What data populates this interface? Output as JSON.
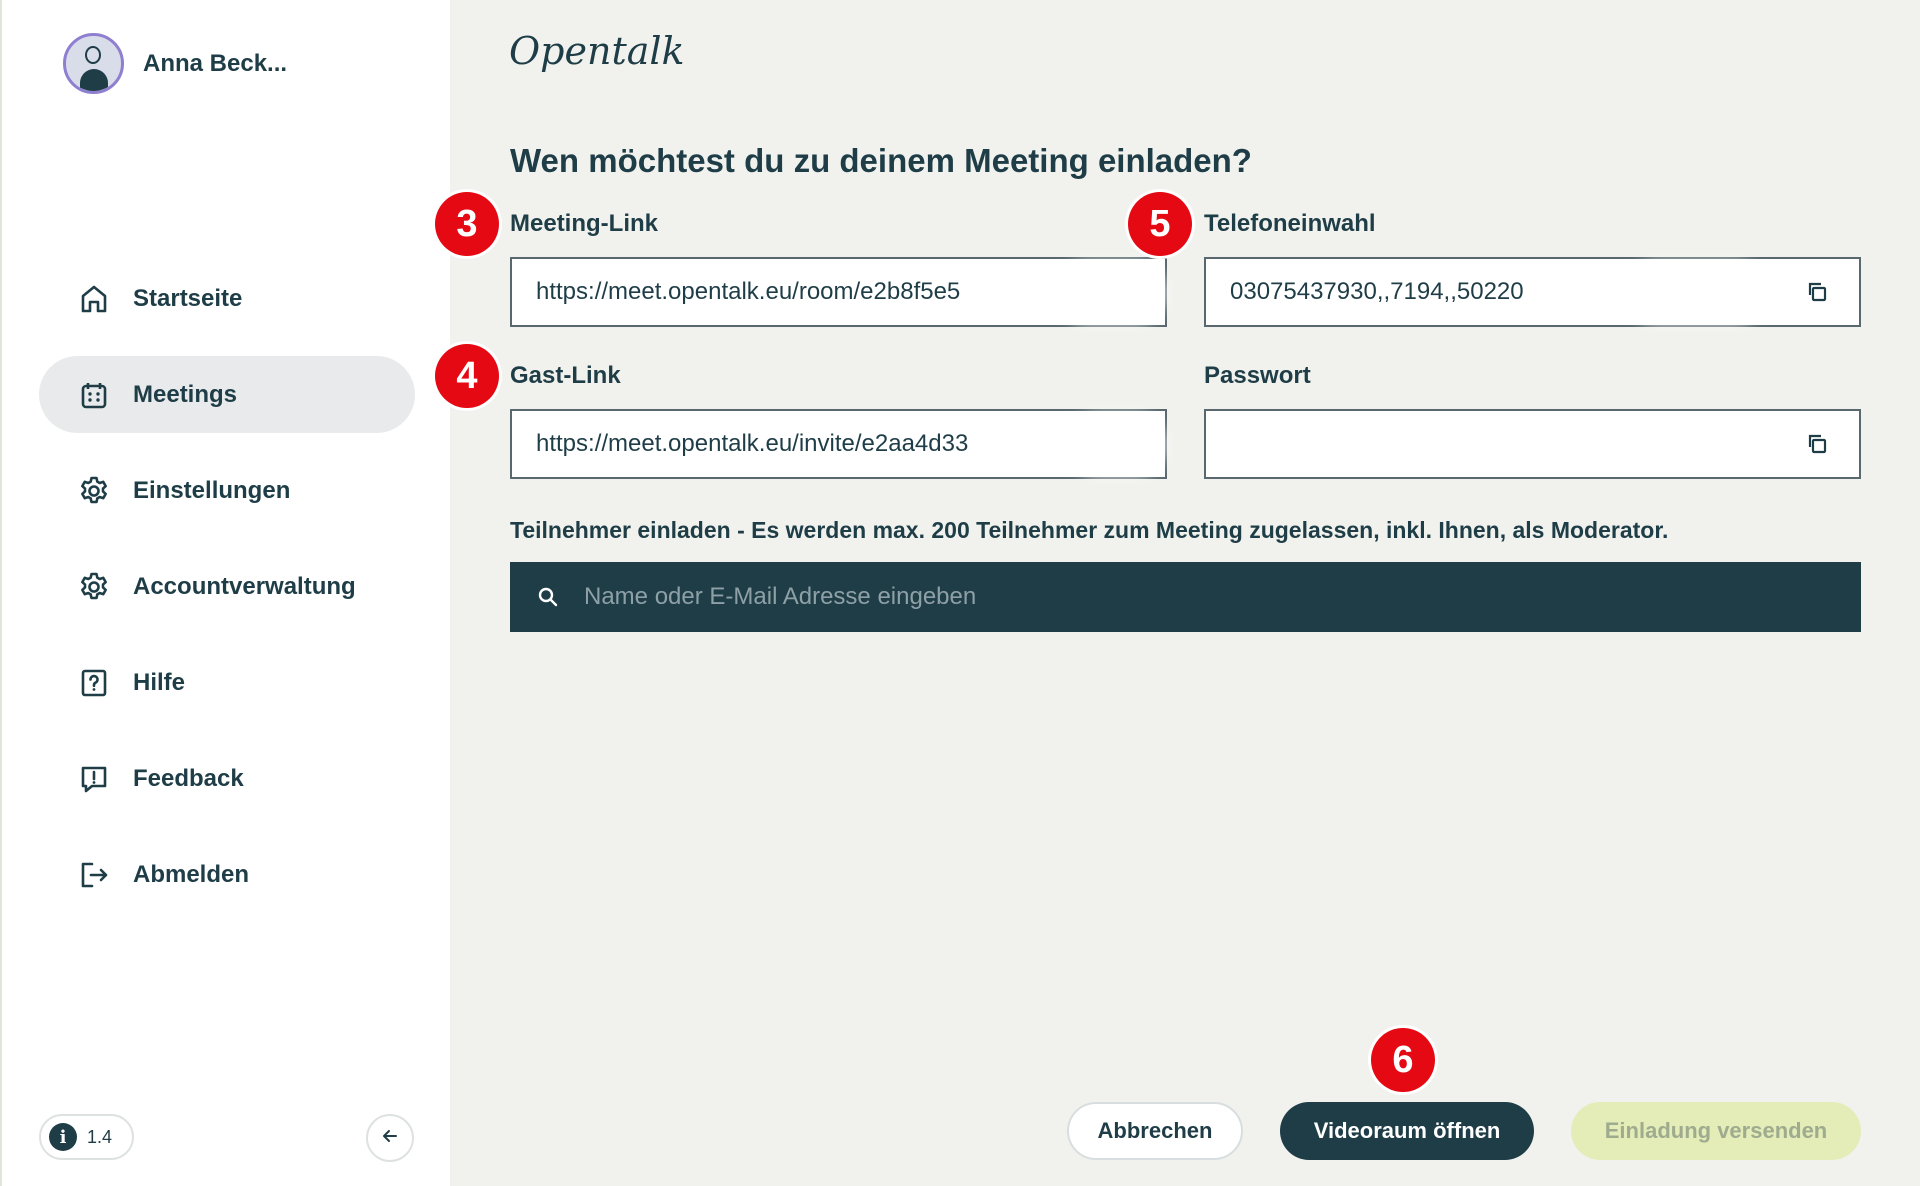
{
  "user": {
    "name": "Anna Beck..."
  },
  "nav": {
    "items": [
      {
        "label": "Startseite",
        "icon": "home-icon"
      },
      {
        "label": "Meetings",
        "icon": "calendar-icon",
        "active": true
      },
      {
        "label": "Einstellungen",
        "icon": "gear-icon"
      },
      {
        "label": "Accountverwaltung",
        "icon": "gear-icon"
      },
      {
        "label": "Hilfe",
        "icon": "help-icon"
      },
      {
        "label": "Feedback",
        "icon": "feedback-icon"
      },
      {
        "label": "Abmelden",
        "icon": "logout-icon"
      }
    ]
  },
  "version": {
    "label": "1.4"
  },
  "brand": {
    "name": "Opentalk"
  },
  "main": {
    "heading": "Wen möchtest du zu deinem Meeting einladen?",
    "meeting_link": {
      "label": "Meeting-Link",
      "value": "https://meet.opentalk.eu/room/e2b8f5e5"
    },
    "phone": {
      "label": "Telefoneinwahl",
      "value": "03075437930,,7194,,50220"
    },
    "guest_link": {
      "label": "Gast-Link",
      "value": "https://meet.opentalk.eu/invite/e2aa4d33"
    },
    "password": {
      "label": "Passwort",
      "value": ""
    },
    "invite_text": "Teilnehmer einladen - Es werden max. 200 Teilnehmer zum Meeting zugelassen, inkl. Ihnen, als Moderator.",
    "search_placeholder": "Name oder E-Mail Adresse eingeben"
  },
  "badges": {
    "b3": "3",
    "b4": "4",
    "b5": "5",
    "b6": "6"
  },
  "actions": {
    "cancel": "Abbrechen",
    "open_room": "Videoraum öffnen",
    "send_invite": "Einladung versenden"
  },
  "colors": {
    "primary": "#1f3d47",
    "accent_disabled": "#e4ecb8",
    "badge": "#e50914",
    "active_nav": "#e8eaeb"
  }
}
